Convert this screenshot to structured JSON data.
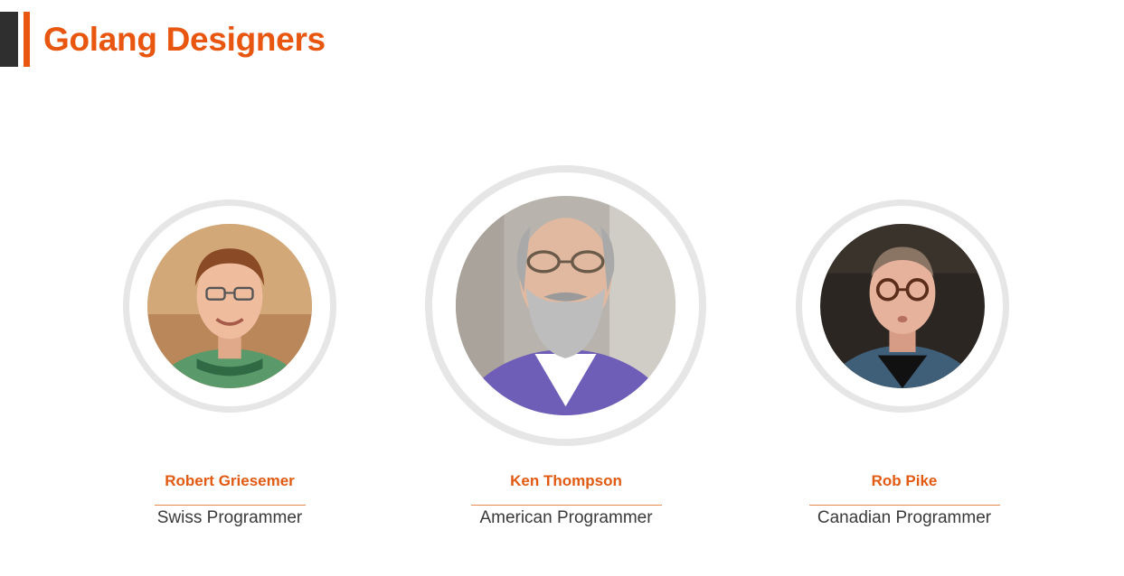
{
  "header": {
    "title": "Golang Designers",
    "accent_dark": "#2f2f2f",
    "accent_orange": "#e8560f"
  },
  "designers": [
    {
      "name": "Robert Griesemer",
      "role": "Swiss Programmer",
      "photo_icon": "portrait-photo"
    },
    {
      "name": "Ken Thompson",
      "role": "American Programmer",
      "photo_icon": "portrait-photo"
    },
    {
      "name": "Rob Pike",
      "role": "Canadian Programmer",
      "photo_icon": "portrait-photo"
    }
  ]
}
